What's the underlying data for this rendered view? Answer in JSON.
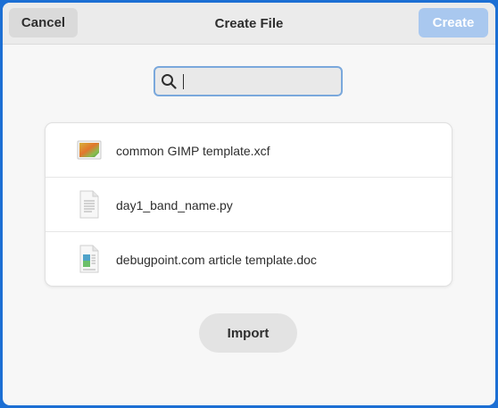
{
  "header": {
    "cancel_label": "Cancel",
    "title": "Create File",
    "create_label": "Create"
  },
  "search": {
    "value": "",
    "icon": "search-icon"
  },
  "files": [
    {
      "name": "common GIMP template.xcf",
      "icon": "image-file-icon"
    },
    {
      "name": "day1_band_name.py",
      "icon": "text-file-icon"
    },
    {
      "name": "debugpoint.com article template.doc",
      "icon": "document-file-icon"
    }
  ],
  "footer": {
    "import_label": "Import"
  },
  "colors": {
    "accent": "#1c6fd4",
    "create_disabled": "#a9c8ef",
    "focus_ring": "#7aa8dc"
  }
}
